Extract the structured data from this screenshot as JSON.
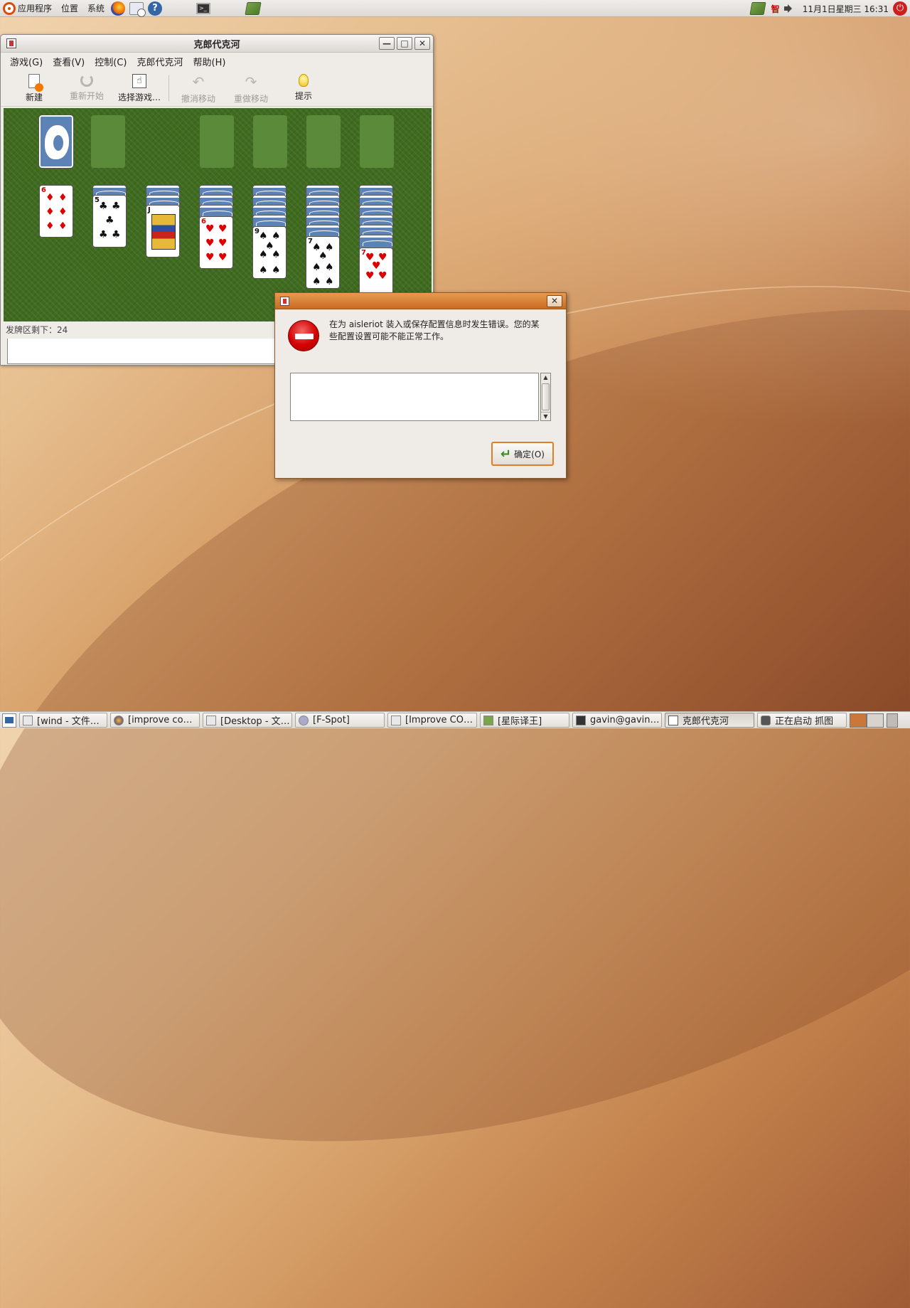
{
  "top_panel": {
    "menus": [
      "应用程序",
      "位置",
      "系统"
    ],
    "clock": "11月1日星期三 16:31",
    "ime_label": "智"
  },
  "window": {
    "title": "克郎代克河",
    "menu": [
      "游戏(G)",
      "查看(V)",
      "控制(C)",
      "克郎代克河",
      "帮助(H)"
    ],
    "toolbar": {
      "new": "新建",
      "restart": "重新开始",
      "select": "选择游戏…",
      "undo": "撤消移动",
      "redo": "重做移动",
      "hint": "提示"
    },
    "status": "发牌区剩下：24",
    "controls": {
      "minimize": "—",
      "maximize": "□",
      "close": "✕"
    }
  },
  "cards": {
    "col1": {
      "rank": "6",
      "suit": "♦"
    },
    "col2": {
      "rank": "5",
      "suit": "♣"
    },
    "col3": {
      "rank": "J",
      "suit": "♣"
    },
    "col4": {
      "rank": "6",
      "suit": "♥"
    },
    "col5": {
      "rank": "9",
      "suit": "♠"
    },
    "col6": {
      "rank": "7",
      "suit": "♠"
    },
    "col7": {
      "rank": "7",
      "suit": "♥"
    }
  },
  "dialog": {
    "message_line1": "在为 aisleriot 装入或保存配置信息时发生错误。您的某",
    "message_line2": "些配置设置可能不能正常工作。",
    "ok_label": "确定(O)",
    "close": "✕"
  },
  "taskbar": {
    "tasks": [
      "[wind - 文件…",
      "[improve co…",
      "[Desktop - 文…",
      "[F-Spot]",
      "[Improve CO…",
      "[星际译王]",
      "gavin@gavin…",
      "克郎代克河",
      "正在启动 抓图"
    ]
  },
  "colors": {
    "felt": "#3f6b1f",
    "card_back": "#5d83b6",
    "dialog_title": "#d9843a",
    "ok_border": "#e07d28",
    "error": "#d40000"
  }
}
